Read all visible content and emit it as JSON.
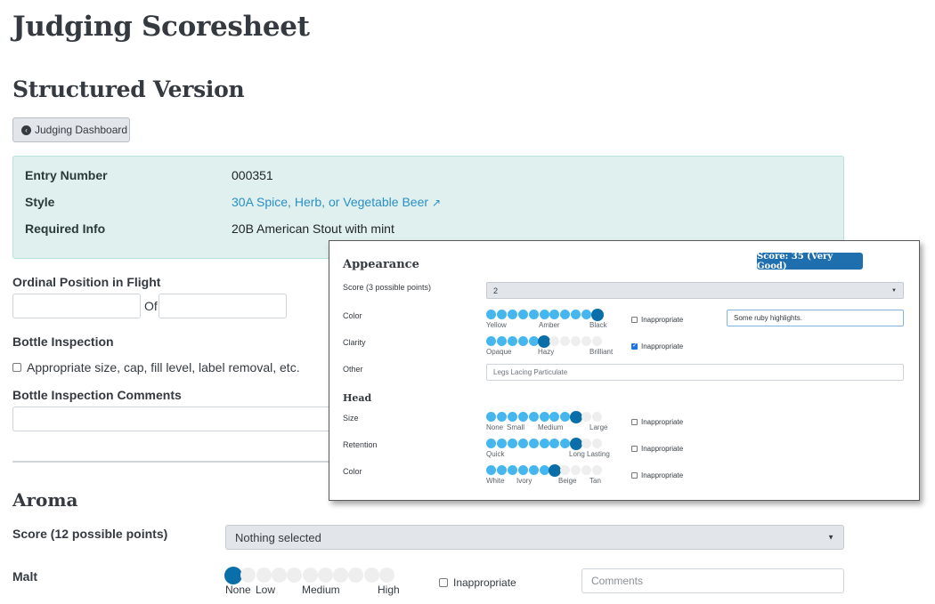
{
  "page": {
    "title": "Judging Scoresheet",
    "subtitle": "Structured Version",
    "dashboard_button": "Judging Dashboard",
    "colors": {
      "accent": "#1f6fae",
      "info_bg": "#dff0ee",
      "slider_fill": "#45b7ee",
      "slider_handle": "#0a6fa8"
    }
  },
  "entry": {
    "entry_number_label": "Entry Number",
    "entry_number": "000351",
    "style_label": "Style",
    "style_value": "30A Spice, Herb, or Vegetable Beer",
    "required_info_label": "Required Info",
    "required_info": "20B American Stout with mint"
  },
  "flight": {
    "ordinal_label": "Ordinal Position in Flight",
    "of_label": "Of",
    "bottle_inspection_label": "Bottle Inspection",
    "bottle_checkbox_label": "Appropriate size, cap, fill level, label removal, etc.",
    "bottle_comments_label": "Bottle Inspection Comments"
  },
  "aroma": {
    "heading": "Aroma",
    "score_label": "Score (12 possible points)",
    "score_value": "Nothing selected",
    "malt_label": "Malt",
    "malt_level": 0,
    "malt_ticks": [
      "None",
      "Low",
      "Medium",
      "High"
    ],
    "inappropriate_label": "Inappropriate",
    "comments_placeholder": "Comments"
  },
  "appearance_panel": {
    "heading": "Appearance",
    "badge": "Score: 35 (Very Good)",
    "score_label": "Score (3 possible points)",
    "score_value": "2",
    "inappropriate_label": "Inappropriate",
    "color": {
      "label": "Color",
      "level": 1.0,
      "ticks": [
        "Yellow",
        "Amber",
        "Black"
      ],
      "comment": "Some ruby highlights.",
      "inappropriate": false
    },
    "clarity": {
      "label": "Clarity",
      "level": 0.5,
      "ticks": [
        "Opaque",
        "Hazy",
        "Brilliant"
      ],
      "inappropriate": true
    },
    "other": {
      "label": "Other",
      "placeholder": "Legs Lacing Particulate"
    },
    "head_heading": "Head",
    "size": {
      "label": "Size",
      "level": 0.75,
      "ticks": [
        "None",
        "Small",
        "Medium",
        "Large"
      ],
      "inappropriate": false
    },
    "retention": {
      "label": "Retention",
      "level": 0.75,
      "ticks": [
        "Quick",
        "Long Lasting"
      ],
      "inappropriate": false
    },
    "head_color": {
      "label": "Color",
      "level": 0.625,
      "ticks": [
        "White",
        "Ivory",
        "Beige",
        "Tan"
      ],
      "inappropriate": false
    }
  }
}
